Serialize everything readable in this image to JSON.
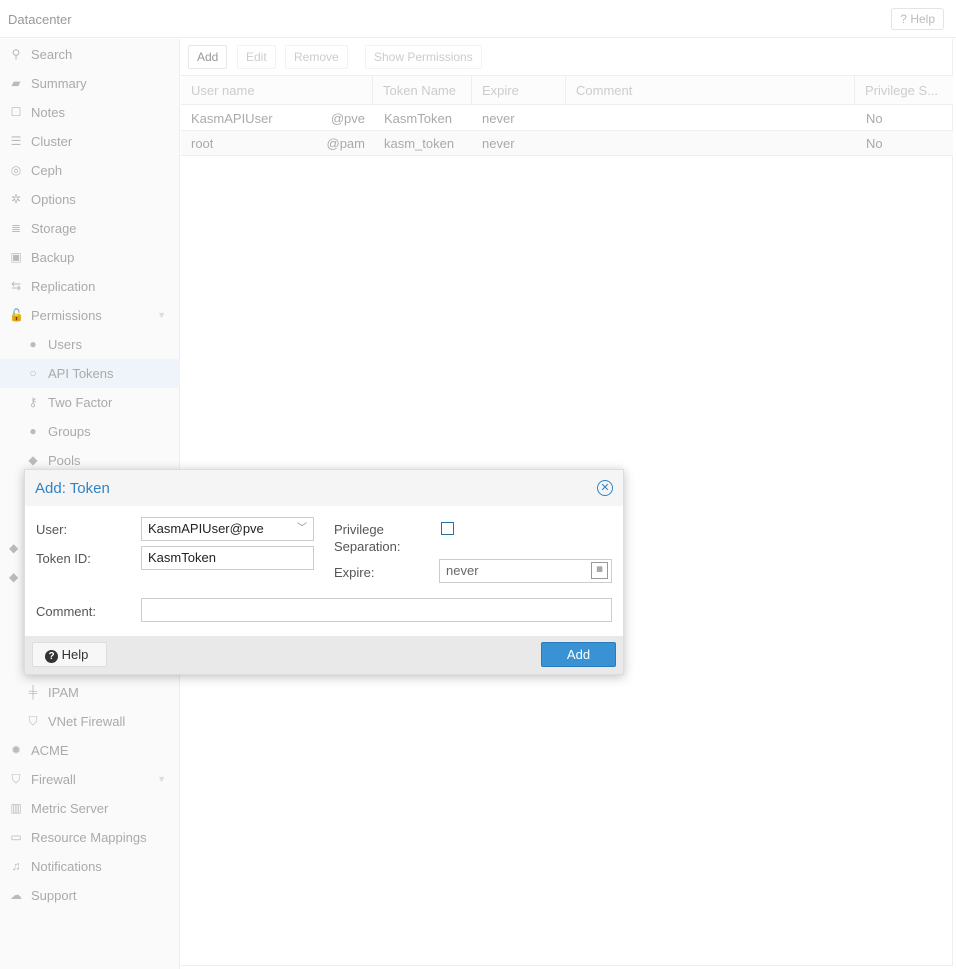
{
  "header": {
    "title": "Datacenter",
    "help": "Help"
  },
  "sidebar": {
    "items": [
      {
        "label": "Search",
        "icon": "search-icon",
        "g": "⚲"
      },
      {
        "label": "Summary",
        "icon": "book-icon",
        "g": "▰"
      },
      {
        "label": "Notes",
        "icon": "note-icon",
        "g": "☐"
      },
      {
        "label": "Cluster",
        "icon": "server-icon",
        "g": "☰"
      },
      {
        "label": "Ceph",
        "icon": "ceph-icon",
        "g": "◎"
      },
      {
        "label": "Options",
        "icon": "gear-icon",
        "g": "✲"
      },
      {
        "label": "Storage",
        "icon": "database-icon",
        "g": "≣"
      },
      {
        "label": "Backup",
        "icon": "floppy-icon",
        "g": "▣"
      },
      {
        "label": "Replication",
        "icon": "retweet-icon",
        "g": "⇆"
      },
      {
        "label": "Permissions",
        "icon": "unlock-icon",
        "g": "🔓"
      },
      {
        "label": "Users",
        "icon": "user-icon",
        "g": "●",
        "sub": true
      },
      {
        "label": "API Tokens",
        "icon": "user-outline-icon",
        "g": "○",
        "sub": true,
        "selected": true
      },
      {
        "label": "Two Factor",
        "icon": "key-icon",
        "g": "⚷",
        "sub": true
      },
      {
        "label": "Groups",
        "icon": "users-icon",
        "g": "●",
        "sub": true
      },
      {
        "label": "Pools",
        "icon": "tags-icon",
        "g": "◆",
        "sub": true
      }
    ],
    "lower": [
      {
        "label": "IPAM",
        "icon": "signpost-icon",
        "g": "╪",
        "sub": true
      },
      {
        "label": "VNet Firewall",
        "icon": "shield-icon",
        "g": "⛉",
        "sub": true
      },
      {
        "label": "ACME",
        "icon": "certificate-icon",
        "g": "✹"
      },
      {
        "label": "Firewall",
        "icon": "shield-icon",
        "g": "⛉"
      },
      {
        "label": "Metric Server",
        "icon": "bar-chart-icon",
        "g": "▥"
      },
      {
        "label": "Resource Mappings",
        "icon": "folder-icon",
        "g": "▭"
      },
      {
        "label": "Notifications",
        "icon": "bell-icon",
        "g": "♫"
      },
      {
        "label": "Support",
        "icon": "comments-icon",
        "g": "☁"
      }
    ]
  },
  "toolbar": {
    "add": "Add",
    "edit": "Edit",
    "remove": "Remove",
    "show_permissions": "Show Permissions"
  },
  "grid": {
    "columns": [
      "User name",
      "Token Name",
      "Expire",
      "Comment",
      "Privilege S..."
    ],
    "rows": [
      {
        "user": "KasmAPIUser",
        "realm": "@pve",
        "token": "KasmToken",
        "expire": "never",
        "comment": "",
        "privsep": "No"
      },
      {
        "user": "root",
        "realm": "@pam",
        "token": "kasm_token",
        "expire": "never",
        "comment": "",
        "privsep": "No"
      }
    ]
  },
  "dialog": {
    "title": "Add: Token",
    "user_label": "User:",
    "user_value": "KasmAPIUser@pve",
    "tokenid_label": "Token ID:",
    "tokenid_value": "KasmToken",
    "privsep_label_1": "Privilege",
    "privsep_label_2": "Separation:",
    "privsep_checked": false,
    "expire_label": "Expire:",
    "expire_value": "never",
    "comment_label": "Comment:",
    "comment_value": "",
    "help": "Help",
    "add": "Add",
    "accent": "#2f83c7"
  }
}
